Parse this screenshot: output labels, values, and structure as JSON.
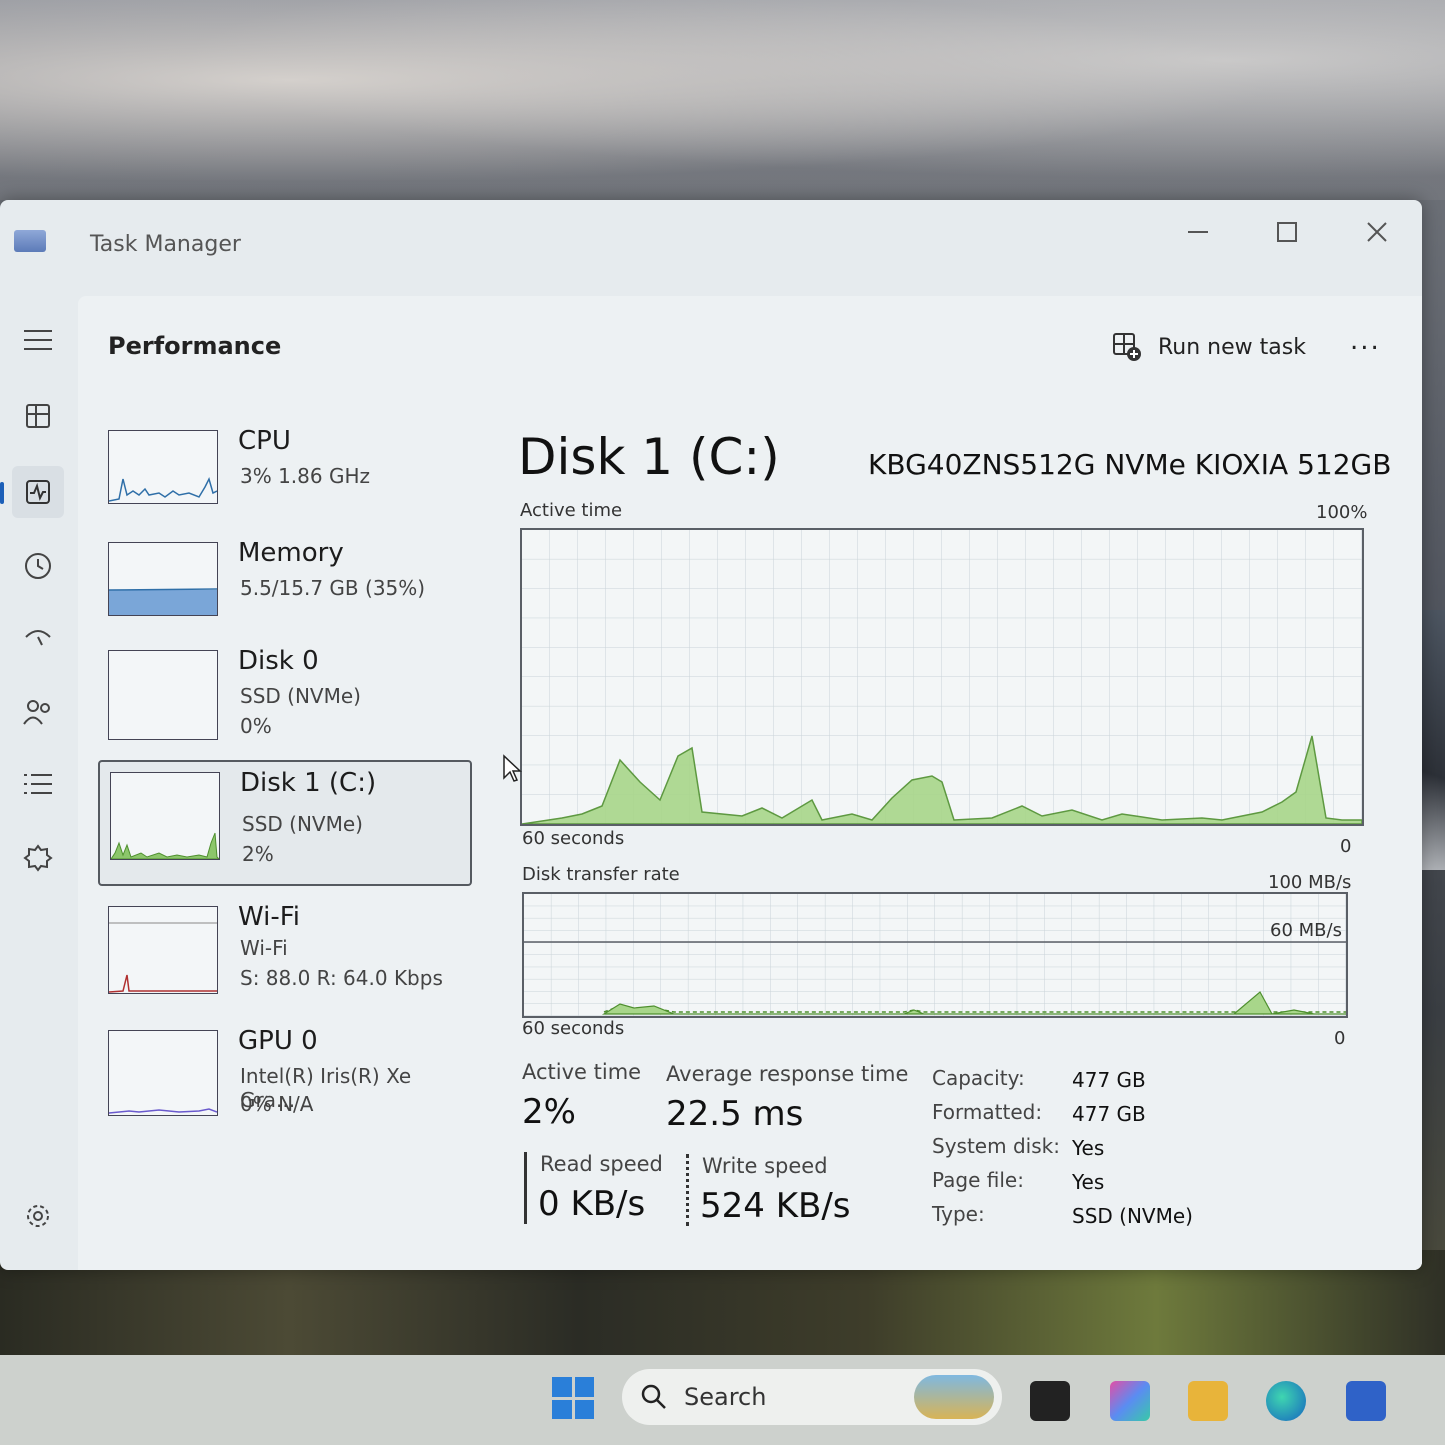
{
  "window": {
    "title": "Task Manager"
  },
  "header": {
    "page_title": "Performance",
    "run_new_task": "Run new task",
    "more": "..."
  },
  "sidebar_tiles": [
    {
      "name": "CPU",
      "line1": "3%  1.86 GHz",
      "line2": ""
    },
    {
      "name": "Memory",
      "line1": "5.5/15.7 GB (35%)",
      "line2": ""
    },
    {
      "name": "Disk 0",
      "line1": "SSD (NVMe)",
      "line2": "0%"
    },
    {
      "name": "Disk 1 (C:)",
      "line1": "SSD (NVMe)",
      "line2": "2%"
    },
    {
      "name": "Wi-Fi",
      "line1": "Wi-Fi",
      "line2": "S: 88.0  R: 64.0 Kbps"
    },
    {
      "name": "GPU 0",
      "line1": "Intel(R) Iris(R) Xe Gra...",
      "line2": "0%  N/A"
    }
  ],
  "detail": {
    "title": "Disk 1 (C:)",
    "model": "KBG40ZNS512G NVMe KIOXIA 512GB",
    "active_time_graph": {
      "label": "Active time",
      "max": "100%",
      "time_span": "60 seconds",
      "min": "0"
    },
    "transfer_graph": {
      "label": "Disk transfer rate",
      "max": "100 MB/s",
      "mid": "60 MB/s",
      "time_span": "60 seconds",
      "min": "0"
    },
    "stats": {
      "active_time_label": "Active time",
      "active_time_value": "2%",
      "avg_response_label": "Average response time",
      "avg_response_value": "22.5 ms",
      "read_label": "Read speed",
      "read_value": "0 KB/s",
      "write_label": "Write speed",
      "write_value": "524 KB/s"
    },
    "properties": [
      {
        "key": "Capacity:",
        "value": "477 GB"
      },
      {
        "key": "Formatted:",
        "value": "477 GB"
      },
      {
        "key": "System disk:",
        "value": "Yes"
      },
      {
        "key": "Page file:",
        "value": "Yes"
      },
      {
        "key": "Type:",
        "value": "SSD (NVMe)"
      }
    ]
  },
  "taskbar": {
    "search_placeholder": "Search"
  },
  "colors": {
    "disk_green": "#8cc66b",
    "disk_line": "#4e8f2e",
    "cpu_line": "#2f6fa8",
    "memory_fill": "#7aa6d8",
    "wifi_line": "#b03030",
    "gpu_line": "#6a5acd",
    "accent": "#1c5fb8"
  },
  "icons": [
    "hamburger-icon",
    "processes-icon",
    "performance-icon",
    "app-history-icon",
    "startup-apps-icon",
    "users-icon",
    "details-icon",
    "services-icon",
    "settings-icon",
    "run-task-icon",
    "minimize-icon",
    "maximize-icon",
    "close-icon",
    "windows-start-icon",
    "search-icon"
  ]
}
